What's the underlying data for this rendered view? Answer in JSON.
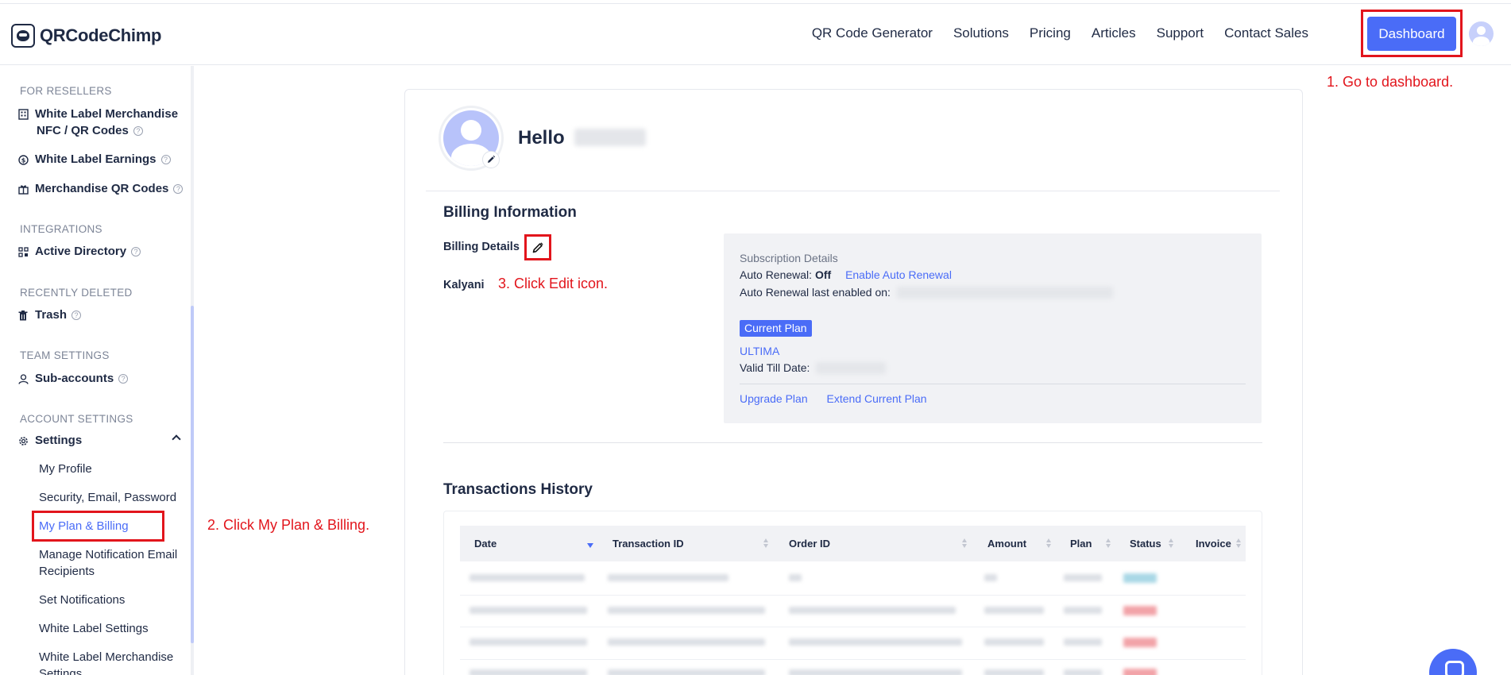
{
  "header": {
    "logo_text": "QRCodeChimp",
    "nav": [
      "QR Code Generator",
      "Solutions",
      "Pricing",
      "Articles",
      "Support",
      "Contact Sales"
    ],
    "dashboard_label": "Dashboard"
  },
  "annotations": {
    "step1": "1. Go to dashboard.",
    "step2": "2. Click My Plan & Billing.",
    "step3": "3. Click Edit icon."
  },
  "sidebar": {
    "sections": {
      "resellers": "FOR RESELLERS",
      "integrations": "INTEGRATIONS",
      "deleted": "RECENTLY DELETED",
      "team": "TEAM SETTINGS",
      "account": "ACCOUNT SETTINGS"
    },
    "items": {
      "wl_merch_line1": "White Label Merchandise",
      "wl_merch_line2": "NFC / QR Codes",
      "wl_earnings": "White Label Earnings",
      "merch_qr": "Merchandise QR Codes",
      "active_directory": "Active Directory",
      "trash": "Trash",
      "sub_accounts": "Sub-accounts",
      "settings": "Settings"
    },
    "settings_sub": {
      "my_profile": "My Profile",
      "security": "Security, Email, Password",
      "plan_billing": "My Plan & Billing",
      "notif_recip_1": "Manage Notification Email",
      "notif_recip_2": "Recipients",
      "set_notifications": "Set Notifications",
      "wl_settings": "White Label Settings",
      "wl_merch_settings_1": "White Label Merchandise",
      "wl_merch_settings_2": "Settings"
    }
  },
  "profile": {
    "hello": "Hello"
  },
  "billing": {
    "title": "Billing Information",
    "details_label": "Billing Details",
    "name": "Kalyani"
  },
  "subscription": {
    "title": "Subscription Details",
    "auto_renewal_label": "Auto Renewal:",
    "auto_renewal_value": "Off",
    "enable_auto_renewal": "Enable Auto Renewal",
    "last_enabled_label": "Auto Renewal last enabled on:",
    "current_plan_badge": "Current Plan",
    "plan_name": "ULTIMA",
    "valid_till_label": "Valid Till Date:",
    "upgrade_plan": "Upgrade Plan",
    "extend_plan": "Extend Current Plan"
  },
  "transactions": {
    "title": "Transactions History",
    "columns": [
      "Date",
      "Transaction ID",
      "Order ID",
      "Amount",
      "Plan",
      "Status",
      "Invoice"
    ]
  },
  "colors": {
    "accent": "#4a6cf7",
    "annotation_red": "#e2151c",
    "text_dark": "#1f2a44"
  }
}
